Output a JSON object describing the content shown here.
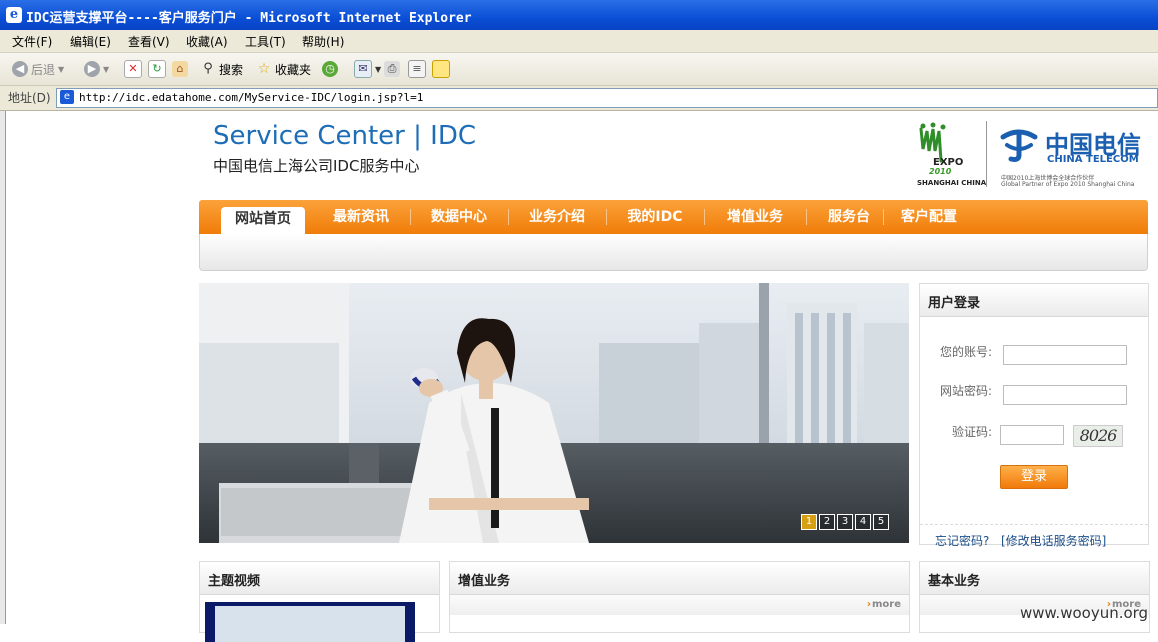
{
  "window": {
    "title": "IDC运营支撑平台----客户服务门户 - Microsoft Internet Explorer"
  },
  "menubar": [
    "文件(F)",
    "编辑(E)",
    "查看(V)",
    "收藏(A)",
    "工具(T)",
    "帮助(H)"
  ],
  "toolbar": {
    "back": "后退",
    "search": "搜索",
    "favorites": "收藏夹"
  },
  "address": {
    "label": "地址(D)",
    "url": "http://idc.edatahome.com/MyService-IDC/login.jsp?l=1"
  },
  "header": {
    "title_en": "Service Center | IDC",
    "title_cn": "中国电信上海公司IDC服务中心",
    "expo_word": "EXPO",
    "expo_year": "2010",
    "expo_city": "SHANGHAI CHINA",
    "telecom_cn": "中国电信",
    "telecom_en": "CHINA TELECOM",
    "telecom_sub1": "中国2010上海世博会全球合作伙伴",
    "telecom_sub2": "Global Partner of Expo 2010 Shanghai China"
  },
  "nav": {
    "items": [
      "网站首页",
      "最新资讯",
      "数据中心",
      "业务介绍",
      "我的IDC",
      "增值业务",
      "服务台",
      "客户配置"
    ],
    "active_index": 0
  },
  "banner": {
    "pages": [
      "1",
      "2",
      "3",
      "4",
      "5"
    ],
    "current_page": "1"
  },
  "login": {
    "title": "用户登录",
    "account_label": "您的账号:",
    "password_label": "网站密码:",
    "captcha_label": "验证码:",
    "captcha_value": "8026",
    "submit_label": "登录",
    "forgot_link": "忘记密码?",
    "modify_link": "[修改电话服务密码]"
  },
  "panels": {
    "video_title": "主题视频",
    "value_added_title": "增值业务",
    "value_added_more": "more",
    "basic_title": "基本业务",
    "basic_more": "more"
  },
  "watermark": "www.wooyun.org",
  "colors": {
    "nav_orange": "#f07c08",
    "brand_blue": "#1d6db7",
    "titlebar_blue": "#0a4fd6",
    "login_button": "#f07a0a"
  }
}
